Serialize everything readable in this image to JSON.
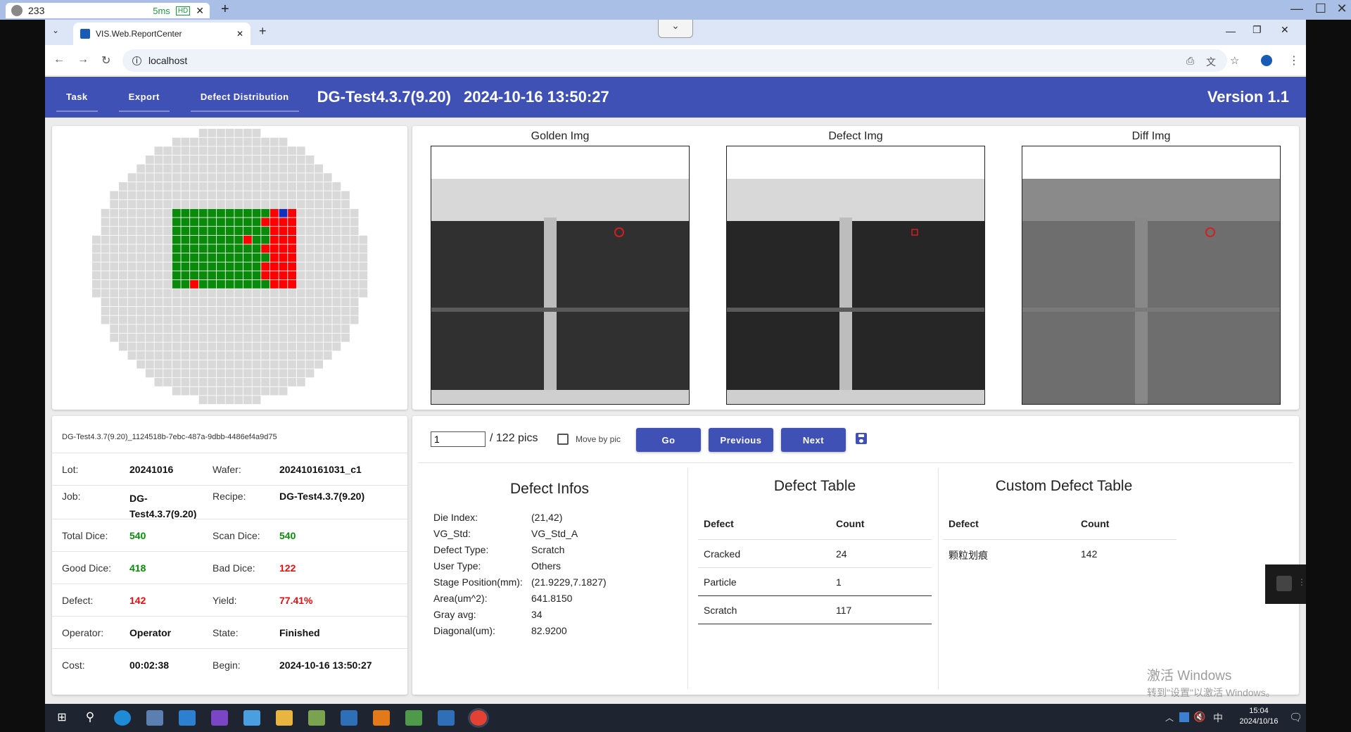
{
  "remote": {
    "tab_title": "233",
    "ping": "5ms",
    "hd": "HD",
    "close": "✕",
    "add": "+",
    "min": "—",
    "max": "☐",
    "close_win": "✕"
  },
  "browser": {
    "tab_title": "VIS.Web.ReportCenter",
    "tab_close": "✕",
    "new_tab": "+",
    "url": "localhost",
    "min": "—",
    "restore": "❐",
    "close": "✕"
  },
  "appbar": {
    "task": "Task",
    "export": "Export",
    "defect_dist": "Defect Distribution",
    "title": "DG-Test4.3.7(9.20)",
    "time": "2024-10-16 13:50:27",
    "version": "Version 1.1"
  },
  "images": {
    "golden": "Golden Img",
    "defect": "Defect Img",
    "diff": "Diff Img"
  },
  "wafer": {
    "cols": 31,
    "rows": 31,
    "good_color": "#0a8a0a",
    "bad_color": "#ff0000",
    "empty_color": "#d9d9d9"
  },
  "info": {
    "id": "DG-Test4.3.7(9.20)_1124518b-7ebc-487a-9dbb-4486ef4a9d75",
    "lot_label": "Lot:",
    "lot": "20241016",
    "wafer_label": "Wafer:",
    "wafer": "202410161031_c1",
    "job_label": "Job:",
    "job": "DG-Test4.3.7(9.20)",
    "recipe_label": "Recipe:",
    "recipe": "DG-Test4.3.7(9.20)",
    "total_label": "Total Dice:",
    "total": "540",
    "scan_label": "Scan Dice:",
    "scan": "540",
    "good_label": "Good Dice:",
    "good": "418",
    "bad_label": "Bad Dice:",
    "bad": "122",
    "defect_label": "Defect:",
    "defect": "142",
    "yield_label": "Yield:",
    "yield": "77.41%",
    "operator_label": "Operator:",
    "operator": "Operator",
    "state_label": "State:",
    "state": "Finished",
    "cost_label": "Cost:",
    "cost": "00:02:38",
    "begin_label": "Begin:",
    "begin": "2024-10-16 13:50:27"
  },
  "pager": {
    "page_value": "1",
    "total": "/ 122 pics",
    "move_by_pic": "Move by pic",
    "go": "Go",
    "previous": "Previous",
    "next": "Next"
  },
  "defect_infos": {
    "title": "Defect Infos",
    "rows": [
      {
        "label": "Die Index:",
        "value": "(21,42)"
      },
      {
        "label": "VG_Std:",
        "value": "VG_Std_A"
      },
      {
        "label": "Defect Type:",
        "value": "Scratch"
      },
      {
        "label": "User Type:",
        "value": "Others"
      },
      {
        "label": "Stage Position(mm):",
        "value": "(21.9229,7.1827)"
      },
      {
        "label": "Area(um^2):",
        "value": "641.8150"
      },
      {
        "label": "Gray avg:",
        "value": "34"
      },
      {
        "label": "Diagonal(um):",
        "value": "82.9200"
      }
    ]
  },
  "defect_table": {
    "title": "Defect Table",
    "h_defect": "Defect",
    "h_count": "Count",
    "rows": [
      {
        "defect": "Cracked",
        "count": "24"
      },
      {
        "defect": "Particle",
        "count": "1"
      },
      {
        "defect": "Scratch",
        "count": "117"
      }
    ]
  },
  "custom_table": {
    "title": "Custom Defect Table",
    "h_defect": "Defect",
    "h_count": "Count",
    "rows": [
      {
        "defect": "颗粒划痕",
        "count": "142"
      }
    ]
  },
  "watermark": {
    "line1": "激活 Windows",
    "line2": "转到\"设置\"以激活 Windows。"
  },
  "taskbar": {
    "time": "15:04",
    "date": "2024/10/16",
    "ime": "中"
  }
}
